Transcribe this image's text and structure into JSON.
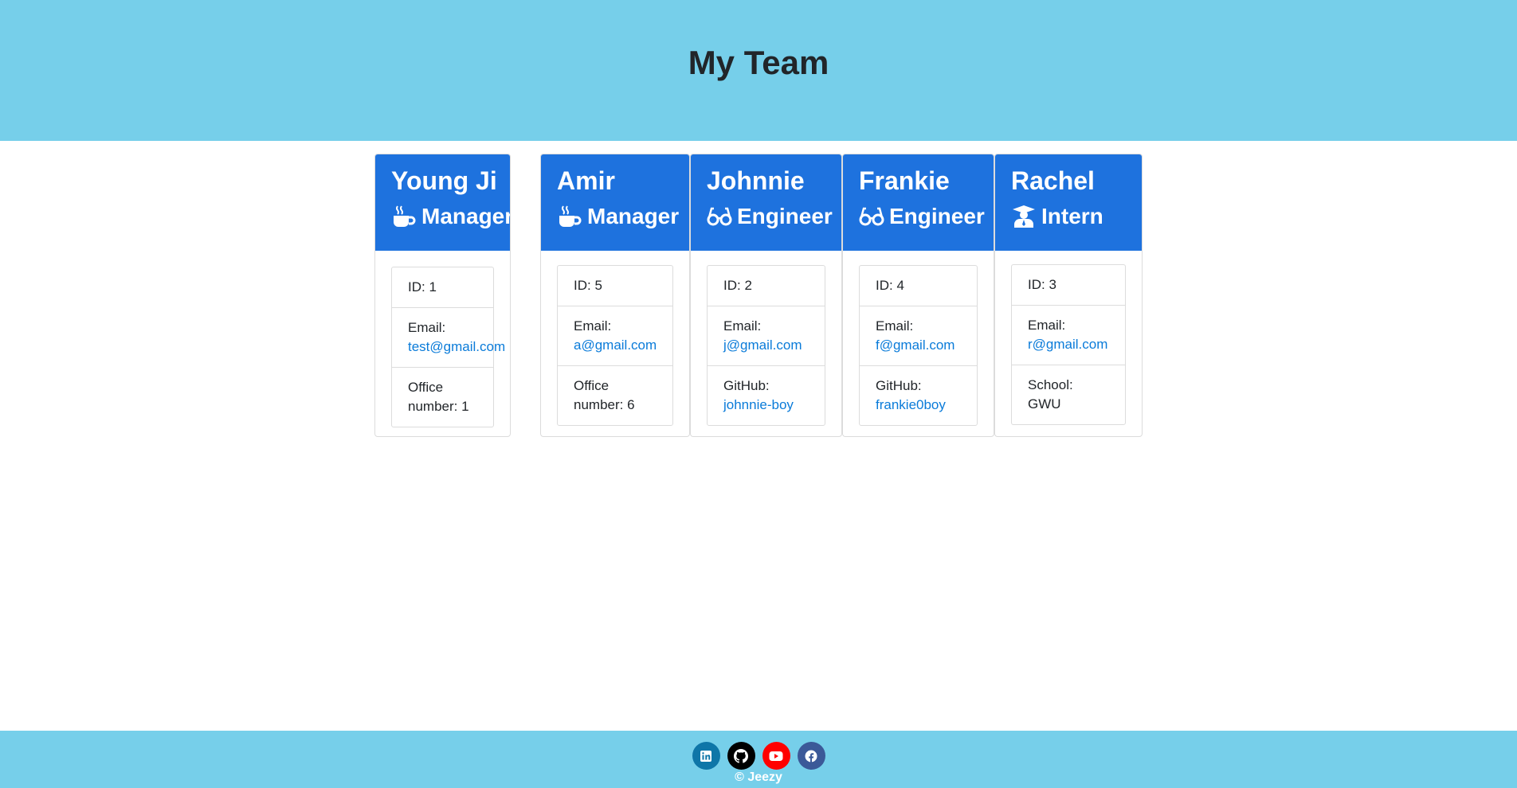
{
  "header": {
    "title": "My Team"
  },
  "team": [
    {
      "name": "Young Ji",
      "role": "Manager",
      "role_icon": "mug-icon",
      "id_label": "ID: 1",
      "email_label": "Email:",
      "email": "test@gmail.com",
      "extra_label": "Office number: 1",
      "extra_link": ""
    },
    {
      "name": "Amir",
      "role": "Manager",
      "role_icon": "mug-icon",
      "id_label": "ID: 5",
      "email_label": "Email:",
      "email": "a@gmail.com",
      "extra_label": "Office number: 6",
      "extra_link": ""
    },
    {
      "name": "Johnnie",
      "role": "Engineer",
      "role_icon": "glasses-icon",
      "id_label": "ID: 2",
      "email_label": "Email:",
      "email": "j@gmail.com",
      "extra_label": "GitHub:",
      "extra_link": "johnnie-boy"
    },
    {
      "name": "Frankie",
      "role": "Engineer",
      "role_icon": "glasses-icon",
      "id_label": "ID: 4",
      "email_label": "Email:",
      "email": "f@gmail.com",
      "extra_label": "GitHub:",
      "extra_link": "frankie0boy"
    },
    {
      "name": "Rachel",
      "role": "Intern",
      "role_icon": "graduate-icon",
      "id_label": "ID: 3",
      "email_label": "Email:",
      "email": "r@gmail.com",
      "extra_label": "School: GWU",
      "extra_link": ""
    }
  ],
  "footer": {
    "socials": [
      {
        "name": "linkedin-icon",
        "color": "#0e76a8"
      },
      {
        "name": "github-icon",
        "color": "#000000"
      },
      {
        "name": "youtube-icon",
        "color": "#ff0000"
      },
      {
        "name": "facebook-icon",
        "color": "#3b5998"
      }
    ],
    "copyright": "© Jeezy"
  },
  "colors": {
    "header_bg": "#76cfea",
    "card_head_bg": "#1e72de",
    "link": "#0a7bd9"
  }
}
